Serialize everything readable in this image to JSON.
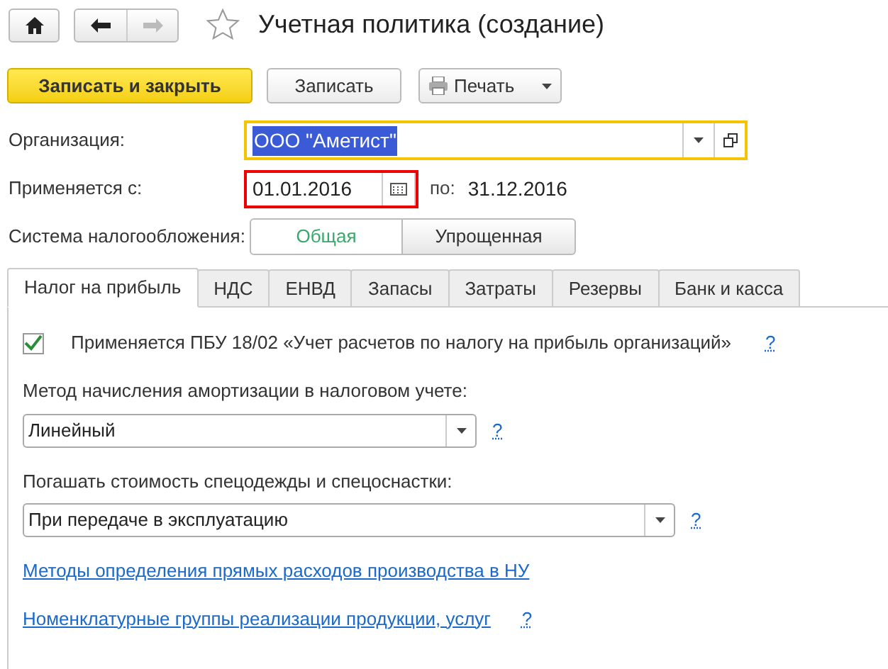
{
  "window": {
    "title": "Учетная политика (создание)",
    "favorite": false
  },
  "nav_buttons": [
    {
      "kind": "back",
      "disabled": false
    },
    {
      "kind": "forward",
      "disabled": true
    }
  ],
  "toolbar": [
    {
      "kind": "primary",
      "label": "Записать и закрыть"
    },
    {
      "kind": "plain",
      "label": "Записать"
    },
    {
      "kind": "print",
      "label": "Печать"
    }
  ],
  "organization": {
    "label": "Организация:",
    "value": "ООО \"Аметист\""
  },
  "period": {
    "label": "Применяется с:",
    "from": "01.01.2016",
    "to_label": "по:",
    "to": "31.12.2016"
  },
  "tax_system": {
    "label": "Система налогообложения:",
    "options": [
      {
        "label": "Общая",
        "selected": true
      },
      {
        "label": "Упрощенная",
        "selected": false
      }
    ]
  },
  "tabs": [
    {
      "label": "Налог на прибыль",
      "selected": true
    },
    {
      "label": "НДС",
      "selected": false
    },
    {
      "label": "ЕНВД",
      "selected": false
    },
    {
      "label": "Запасы",
      "selected": false
    },
    {
      "label": "Затраты",
      "selected": false
    },
    {
      "label": "Резервы",
      "selected": false
    },
    {
      "label": "Банк и касса",
      "selected": false
    }
  ],
  "content": [
    {
      "kind": "checkbox",
      "label": "Применяется ПБУ 18/02 «Учет расчетов по налогу на прибыль организаций»",
      "checked": true,
      "help": "?"
    },
    {
      "kind": "select",
      "label": "Метод начисления амортизации в налоговом учете:",
      "value": "Линейный",
      "help": "?"
    },
    {
      "kind": "wide_select",
      "label": "Погашать стоимость спецодежды и спецоснастки:",
      "value": "При передаче в эксплуатацию",
      "help": "?"
    },
    {
      "kind": "link",
      "label": "Методы определения прямых расходов производства в НУ"
    },
    {
      "kind": "link",
      "label": "Номенклатурные группы реализации продукции, услуг",
      "help": "?"
    }
  ]
}
